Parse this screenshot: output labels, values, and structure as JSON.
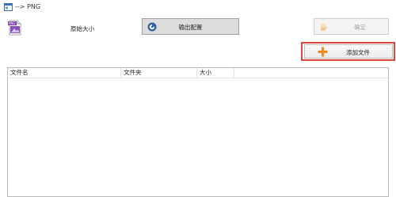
{
  "window": {
    "title": "--> PNG",
    "icon": "app-window-icon"
  },
  "format_icon": {
    "icon": "png-file-icon",
    "badge_text": "PNG"
  },
  "options": {
    "size_label": "原始大小"
  },
  "toolbar": {
    "output_settings_label": "输出配置",
    "output_settings_icon": "settings-circle-icon",
    "confirm_label": "确定",
    "confirm_icon": "confirm-arrow-icon",
    "confirm_enabled": false,
    "add_file_label": "添加文件",
    "add_file_icon": "plus-icon"
  },
  "file_list": {
    "columns": [
      "文件名",
      "文件夹",
      "大小"
    ],
    "rows": []
  },
  "colors": {
    "highlight_border": "#e0423f",
    "plus_icon": "#f08a1c",
    "disabled_text": "#a8a8a8"
  }
}
